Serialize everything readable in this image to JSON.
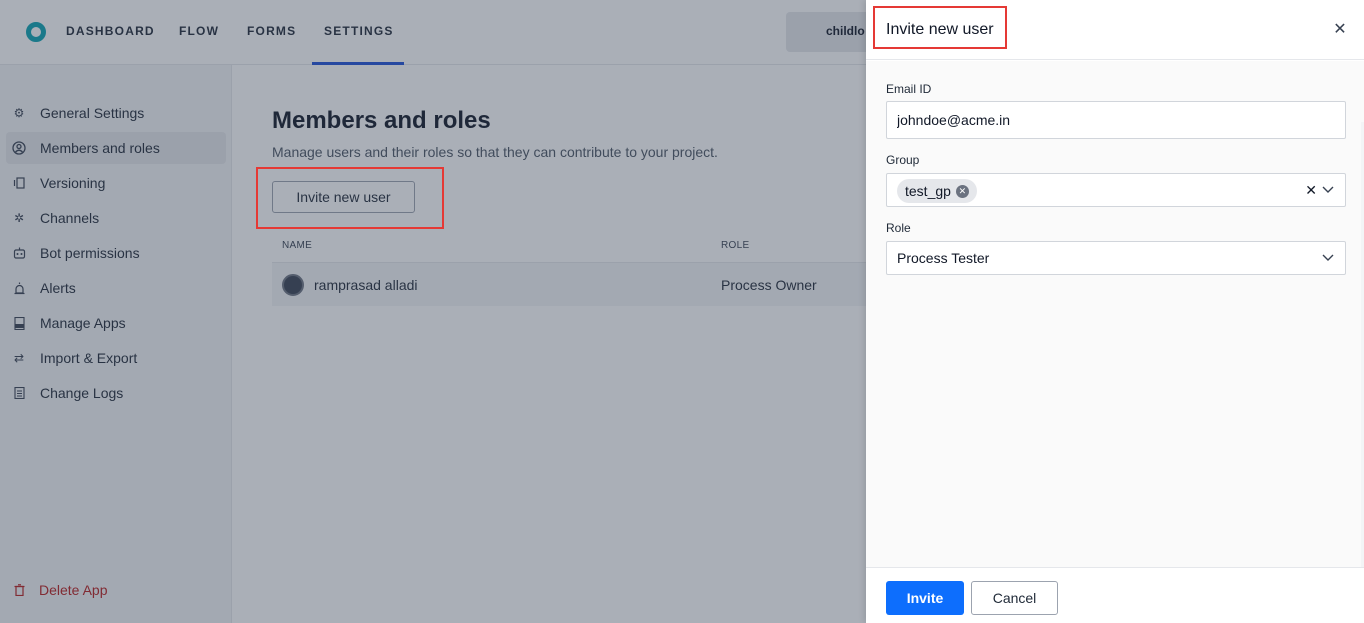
{
  "nav": {
    "items": [
      "DASHBOARD",
      "FLOW",
      "FORMS",
      "SETTINGS"
    ],
    "active": "SETTINGS",
    "env_label": "childlo"
  },
  "sidebar": {
    "items": [
      {
        "label": "General Settings",
        "icon": "gear-icon"
      },
      {
        "label": "Members and roles",
        "icon": "user-circle-icon"
      },
      {
        "label": "Versioning",
        "icon": "versioning-icon"
      },
      {
        "label": "Channels",
        "icon": "channels-icon"
      },
      {
        "label": "Bot permissions",
        "icon": "bot-icon"
      },
      {
        "label": "Alerts",
        "icon": "alarm-icon"
      },
      {
        "label": "Manage Apps",
        "icon": "apk-icon"
      },
      {
        "label": "Import & Export",
        "icon": "arrows-icon"
      },
      {
        "label": "Change Logs",
        "icon": "log-icon"
      }
    ],
    "active_index": 1,
    "delete_label": "Delete App"
  },
  "main": {
    "title": "Members and roles",
    "subtitle": "Manage users and their roles so that they can contribute to your project.",
    "invite_label": "Invite new user",
    "columns": [
      "NAME",
      "ROLE"
    ],
    "rows": [
      {
        "name": "ramprasad alladi",
        "role": "Process Owner"
      }
    ]
  },
  "drawer": {
    "title": "Invite new user",
    "email_label": "Email ID",
    "email_value": "johndoe@acme.in",
    "group_label": "Group",
    "group_chip": "test_gp",
    "role_label": "Role",
    "role_value": "Process Tester",
    "invite_button": "Invite",
    "cancel_button": "Cancel"
  },
  "colors": {
    "primary": "#0d6efd",
    "highlight": "#e53935",
    "brand": "#0aa3b1",
    "danger": "#b91c1c"
  }
}
